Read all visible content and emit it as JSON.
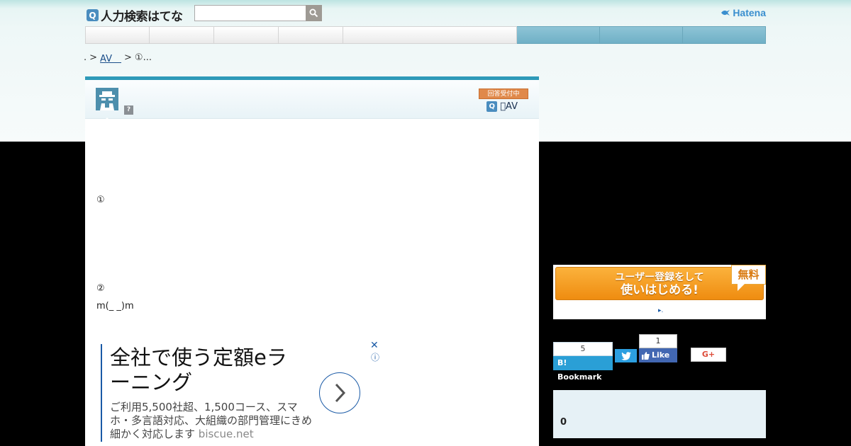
{
  "header": {
    "logo_icon": "Q",
    "logo_text": "人力検索はてな",
    "search_placeholder": "",
    "search_icon": "search-icon",
    "brand": "Hatena"
  },
  "nav": {
    "tabs": [
      "",
      "",
      "",
      "",
      "",
      "",
      "",
      ""
    ]
  },
  "breadcrumb": {
    "items": [
      ".",
      ">",
      "AV　",
      ">",
      "①..."
    ]
  },
  "question": {
    "status": "回答受付中",
    "help_badge": "?",
    "category_icon": "Q",
    "category": "𥳽AV",
    "line1": "①",
    "line2": "②",
    "line3": "m(_ _)m"
  },
  "ad": {
    "title": "全社で使う定額eラーニング",
    "description": "ご利用5,500社超、1,500コース、スマホ・多言語対応、大組織の部門管理にきめ細かく対応します",
    "domain": "biscue.net",
    "close": "✕",
    "info": "ⓘ"
  },
  "register": {
    "line1": "ユーザー登録をして",
    "line2": "使いはじめる!",
    "free": "無料",
    "link": "▸."
  },
  "share": {
    "bookmark_count": "5",
    "bookmark_label": "B! Bookmark",
    "fb_count": "1",
    "fb_label": "Like",
    "gplus_label": "G+"
  },
  "side": {
    "count": "0"
  },
  "colors": {
    "accent": "#2e9ab8",
    "nav_blue": "#7fbacf",
    "orange": "#ef8c10",
    "link": "#1a4e8a"
  }
}
